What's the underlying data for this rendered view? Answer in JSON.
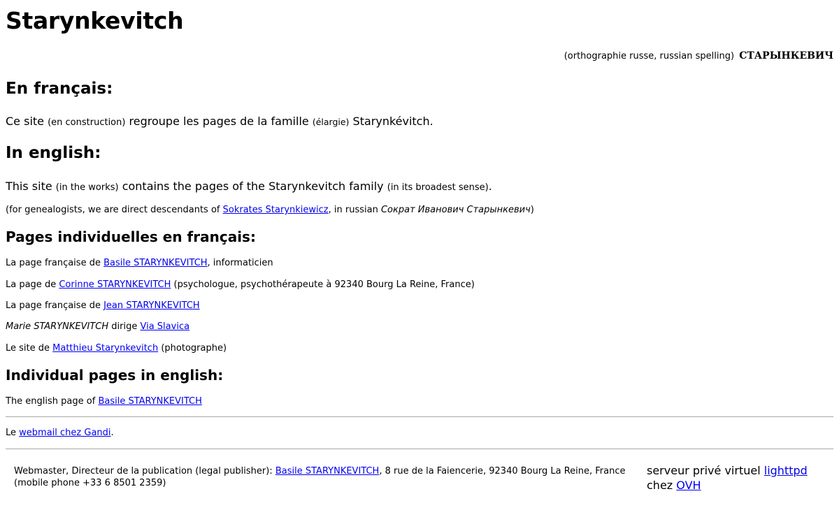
{
  "title": "Starynkevitch",
  "spelling": {
    "prefix": "(orthographie russe, russian spelling)",
    "russian": "СТАРЫНКЕВИЧ"
  },
  "fr_section": {
    "heading": "En français:",
    "text1": "Ce site",
    "note1": "(en construction)",
    "text2": "regroupe les pages de la famille",
    "note2": "(élargie)",
    "text3": "Starynkévitch."
  },
  "en_section": {
    "heading": "In english:",
    "text1": "This site",
    "note1": "(in the works)",
    "text2": "contains the pages of the Starynkevitch family",
    "note2": "(in its broadest sense)",
    "text3": "."
  },
  "genealogy": {
    "prefix": "(for genealogists, we are direct descendants of",
    "link": "Sokrates Starynkiewicz",
    "middle": ", in russian",
    "russian_name": "Сократ Иванович Старынкевич",
    "suffix": ")"
  },
  "pages_fr": {
    "heading": "Pages individuelles en français:",
    "items": [
      {
        "before": "La page française de",
        "link": "Basile STARYNKEVITCH",
        "after": ", informaticien"
      },
      {
        "before": "La page de",
        "link": "Corinne STARYNKEVITCH",
        "after": "(psychologue, psychothérapeute à 92340 Bourg La Reine, France)"
      },
      {
        "before": "La page française de",
        "link": "Jean STARYNKEVITCH",
        "after": ""
      },
      {
        "before_italic": "Marie STARYNKEVITCH",
        "before": "dirige",
        "link": "Via Slavica",
        "after": ""
      },
      {
        "before": "Le site de",
        "link": "Matthieu Starynkevitch",
        "after": "(photographe)"
      }
    ]
  },
  "pages_en": {
    "heading": "Individual pages in english:",
    "items": [
      {
        "before": "The english page of",
        "link": "Basile STARYNKEVITCH"
      }
    ]
  },
  "webmail": {
    "before": "Le",
    "link": "webmail chez Gandi",
    "after": "."
  },
  "footer": {
    "left_prefix": "Webmaster, Directeur de la publication (legal publisher):",
    "left_link": "Basile STARYNKEVITCH",
    "left_suffix": ", 8 rue de la Faiencerie, 92340 Bourg La Reine, France",
    "left_line2": "(mobile phone +33 6 8501 2359)",
    "right_text1": "serveur privé virtuel",
    "right_link1": "lighttpd",
    "right_text2": "chez",
    "right_link2": "OVH"
  },
  "colors": {
    "link": "#0000ee",
    "rule": "#a8a8a8"
  }
}
